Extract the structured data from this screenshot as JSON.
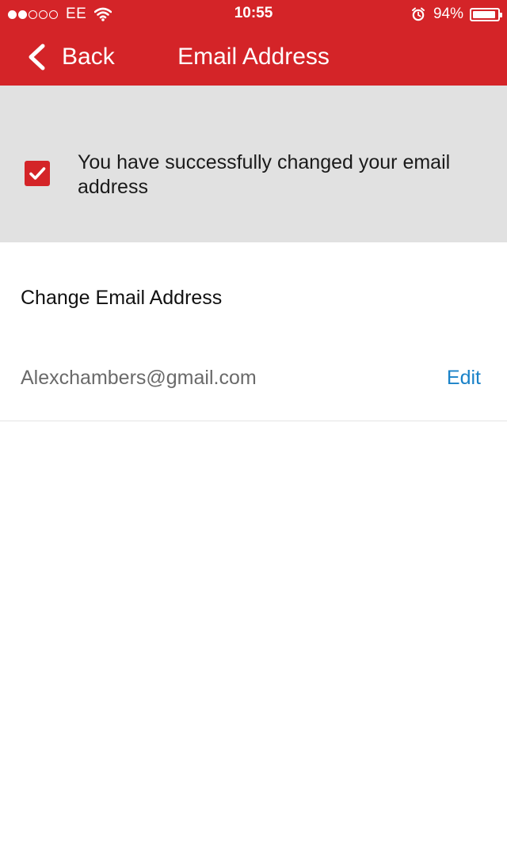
{
  "status_bar": {
    "signal_bars_filled": 2,
    "signal_bars_total": 5,
    "carrier": "EE",
    "time": "10:55",
    "battery_percent_text": "94%",
    "battery_level": 0.94,
    "icons": [
      "wifi-icon",
      "alarm-icon",
      "battery-icon"
    ]
  },
  "nav": {
    "back_label": "Back",
    "title": "Email Address",
    "back_icon": "chevron-left-icon"
  },
  "banner": {
    "message": "You have successfully changed your email address",
    "icon": "checkbox-checked-icon"
  },
  "section": {
    "title": "Change Email Address",
    "email": "Alexchambers@gmail.com",
    "edit_label": "Edit"
  },
  "colors": {
    "brand_red": "#d42428",
    "banner_bg": "#e1e1e1",
    "link_blue": "#1a82c8",
    "email_gray": "#6a6a6a"
  }
}
